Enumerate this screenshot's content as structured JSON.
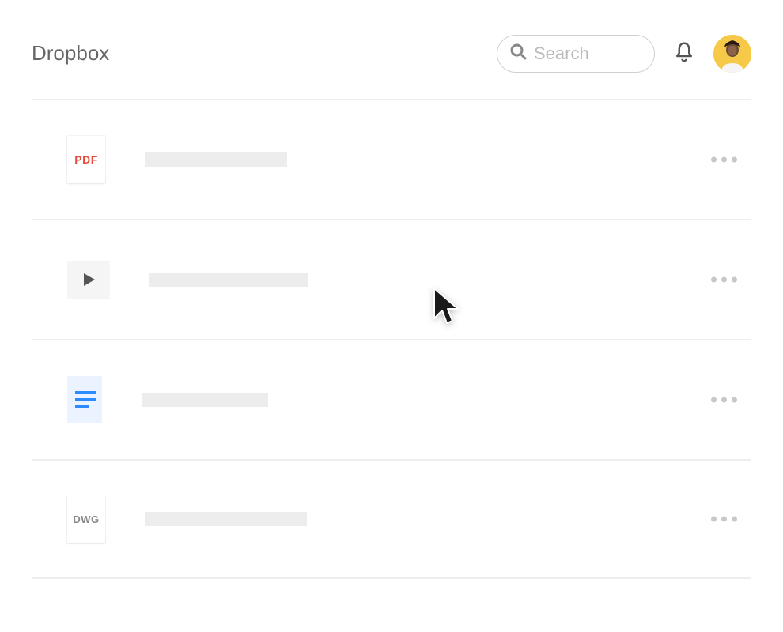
{
  "header": {
    "brand": "Dropbox",
    "search_placeholder": "Search"
  },
  "files": [
    {
      "type": "pdf",
      "type_label": "PDF"
    },
    {
      "type": "video",
      "type_label": ""
    },
    {
      "type": "doc",
      "type_label": ""
    },
    {
      "type": "dwg",
      "type_label": "DWG"
    }
  ]
}
